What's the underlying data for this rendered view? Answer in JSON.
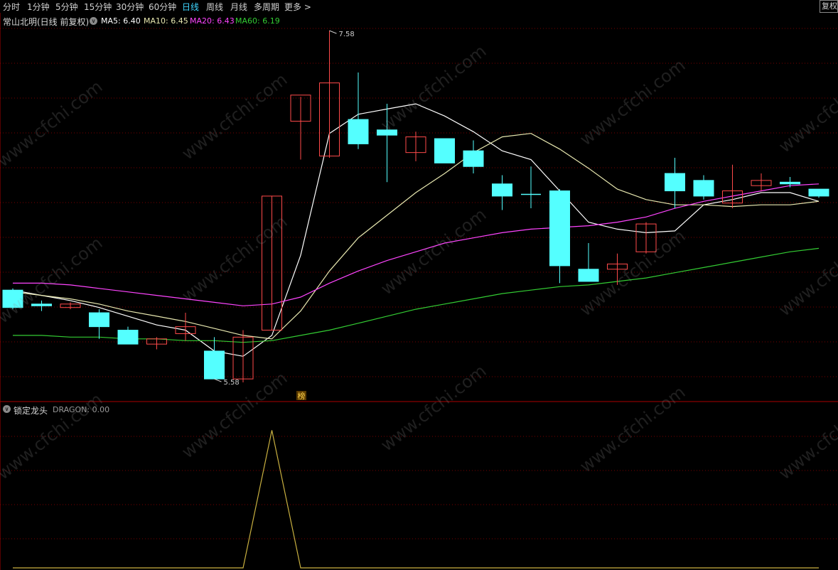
{
  "toolbar": {
    "tabs": [
      "分时",
      "1分钟",
      "5分钟",
      "15分钟",
      "30分钟",
      "60分钟",
      "日线",
      "周线",
      "月线",
      "多周期",
      "更多 >"
    ],
    "active_tab": "日线",
    "right_button": "复权"
  },
  "main_legend": {
    "title": "常山北明(日线 前复权)",
    "ma5": "MA5: 6.40",
    "ma10": "MA10: 6.45",
    "ma20": "MA20: 6.43",
    "ma60": "MA60: 6.19"
  },
  "sub_legend": {
    "title": "锁定龙头",
    "dragon": "DRAGON: 0.00"
  },
  "colors": {
    "up": "#ff4a4a",
    "down": "#54ffff",
    "grid": "#7a0000",
    "ma5": "#ffffff",
    "ma10": "#e8e8b0",
    "ma20": "#ff44ff",
    "ma60": "#33cc33",
    "dragon": "#c9b040",
    "active_tab": "#3fd6ff"
  },
  "watermark": "www.cfchi.com",
  "chart_data": [
    {
      "type": "candlestick",
      "title": "常山北明(日线 前复权)",
      "ylim": [
        5.45,
        7.65
      ],
      "annotations": [
        {
          "label": "7.58",
          "x_index": 11,
          "value": 7.58
        },
        {
          "label": "5.58",
          "x_index": 7,
          "value": 5.58
        }
      ],
      "marker_label": "榜",
      "marker_index": 10,
      "candles": [
        {
          "o": 6.09,
          "h": 6.1,
          "l": 5.98,
          "c": 5.99
        },
        {
          "o": 6.01,
          "h": 6.03,
          "l": 5.97,
          "c": 6.0
        },
        {
          "o": 5.99,
          "h": 6.02,
          "l": 5.98,
          "c": 6.01
        },
        {
          "o": 5.96,
          "h": 5.98,
          "l": 5.81,
          "c": 5.88
        },
        {
          "o": 5.86,
          "h": 5.88,
          "l": 5.78,
          "c": 5.78
        },
        {
          "o": 5.78,
          "h": 5.82,
          "l": 5.75,
          "c": 5.81
        },
        {
          "o": 5.84,
          "h": 5.96,
          "l": 5.8,
          "c": 5.88
        },
        {
          "o": 5.74,
          "h": 5.82,
          "l": 5.58,
          "c": 5.58
        },
        {
          "o": 5.58,
          "h": 5.86,
          "l": 5.56,
          "c": 5.82
        },
        {
          "o": 5.86,
          "h": 6.63,
          "l": 5.86,
          "c": 6.63
        },
        {
          "o": 7.06,
          "h": 7.2,
          "l": 6.84,
          "c": 7.21
        },
        {
          "o": 6.86,
          "h": 7.58,
          "l": 6.85,
          "c": 7.28
        },
        {
          "o": 7.07,
          "h": 7.34,
          "l": 6.9,
          "c": 6.93
        },
        {
          "o": 7.01,
          "h": 7.16,
          "l": 6.71,
          "c": 6.98
        },
        {
          "o": 6.88,
          "h": 7.0,
          "l": 6.83,
          "c": 6.97
        },
        {
          "o": 6.96,
          "h": 6.96,
          "l": 6.82,
          "c": 6.82
        },
        {
          "o": 6.89,
          "h": 6.95,
          "l": 6.76,
          "c": 6.8
        },
        {
          "o": 6.7,
          "h": 6.75,
          "l": 6.55,
          "c": 6.63
        },
        {
          "o": 6.64,
          "h": 6.8,
          "l": 6.56,
          "c": 6.64
        },
        {
          "o": 6.66,
          "h": 6.67,
          "l": 6.13,
          "c": 6.23
        },
        {
          "o": 6.21,
          "h": 6.36,
          "l": 6.14,
          "c": 6.14
        },
        {
          "o": 6.21,
          "h": 6.3,
          "l": 6.12,
          "c": 6.24
        },
        {
          "o": 6.31,
          "h": 6.48,
          "l": 6.3,
          "c": 6.47
        },
        {
          "o": 6.76,
          "h": 6.85,
          "l": 6.56,
          "c": 6.66
        },
        {
          "o": 6.72,
          "h": 6.75,
          "l": 6.61,
          "c": 6.63
        },
        {
          "o": 6.59,
          "h": 6.81,
          "l": 6.56,
          "c": 6.66
        },
        {
          "o": 6.69,
          "h": 6.76,
          "l": 6.66,
          "c": 6.72
        },
        {
          "o": 6.71,
          "h": 6.74,
          "l": 6.68,
          "c": 6.7
        },
        {
          "o": 6.67,
          "h": 6.67,
          "l": 6.62,
          "c": 6.63
        }
      ],
      "series": [
        {
          "name": "MA5",
          "values": [
            6.09,
            6.06,
            6.03,
            5.99,
            5.94,
            5.89,
            5.86,
            5.74,
            5.71,
            5.83,
            6.29,
            6.99,
            7.1,
            7.13,
            7.16,
            7.09,
            7.0,
            6.89,
            6.84,
            6.66,
            6.48,
            6.44,
            6.42,
            6.43,
            6.58,
            6.61,
            6.65,
            6.65,
            6.6
          ]
        },
        {
          "name": "MA10",
          "values": [
            6.08,
            6.06,
            6.04,
            6.01,
            5.97,
            5.94,
            5.91,
            5.87,
            5.83,
            5.81,
            5.97,
            6.2,
            6.39,
            6.52,
            6.65,
            6.76,
            6.88,
            6.97,
            6.99,
            6.9,
            6.79,
            6.67,
            6.61,
            6.58,
            6.58,
            6.57,
            6.58,
            6.58,
            6.6
          ]
        },
        {
          "name": "MA20",
          "values": [
            6.13,
            6.13,
            6.12,
            6.1,
            6.08,
            6.06,
            6.04,
            6.02,
            6.0,
            6.01,
            6.05,
            6.13,
            6.2,
            6.26,
            6.31,
            6.36,
            6.39,
            6.42,
            6.44,
            6.45,
            6.46,
            6.48,
            6.51,
            6.56,
            6.6,
            6.63,
            6.66,
            6.69,
            6.7
          ]
        },
        {
          "name": "MA60",
          "values": [
            5.83,
            5.83,
            5.82,
            5.82,
            5.81,
            5.81,
            5.8,
            5.8,
            5.79,
            5.8,
            5.83,
            5.86,
            5.9,
            5.94,
            5.98,
            6.01,
            6.04,
            6.07,
            6.09,
            6.11,
            6.12,
            6.14,
            6.16,
            6.19,
            6.22,
            6.25,
            6.28,
            6.31,
            6.33
          ]
        }
      ]
    },
    {
      "type": "line",
      "title": "锁定龙头",
      "ylim": [
        0,
        1.1
      ],
      "series": [
        {
          "name": "DRAGON",
          "values": [
            0,
            0,
            0,
            0,
            0,
            0,
            0,
            0,
            0,
            1,
            0,
            0,
            0,
            0,
            0,
            0,
            0,
            0,
            0,
            0,
            0,
            0,
            0,
            0,
            0,
            0,
            0,
            0,
            0
          ]
        }
      ]
    }
  ]
}
